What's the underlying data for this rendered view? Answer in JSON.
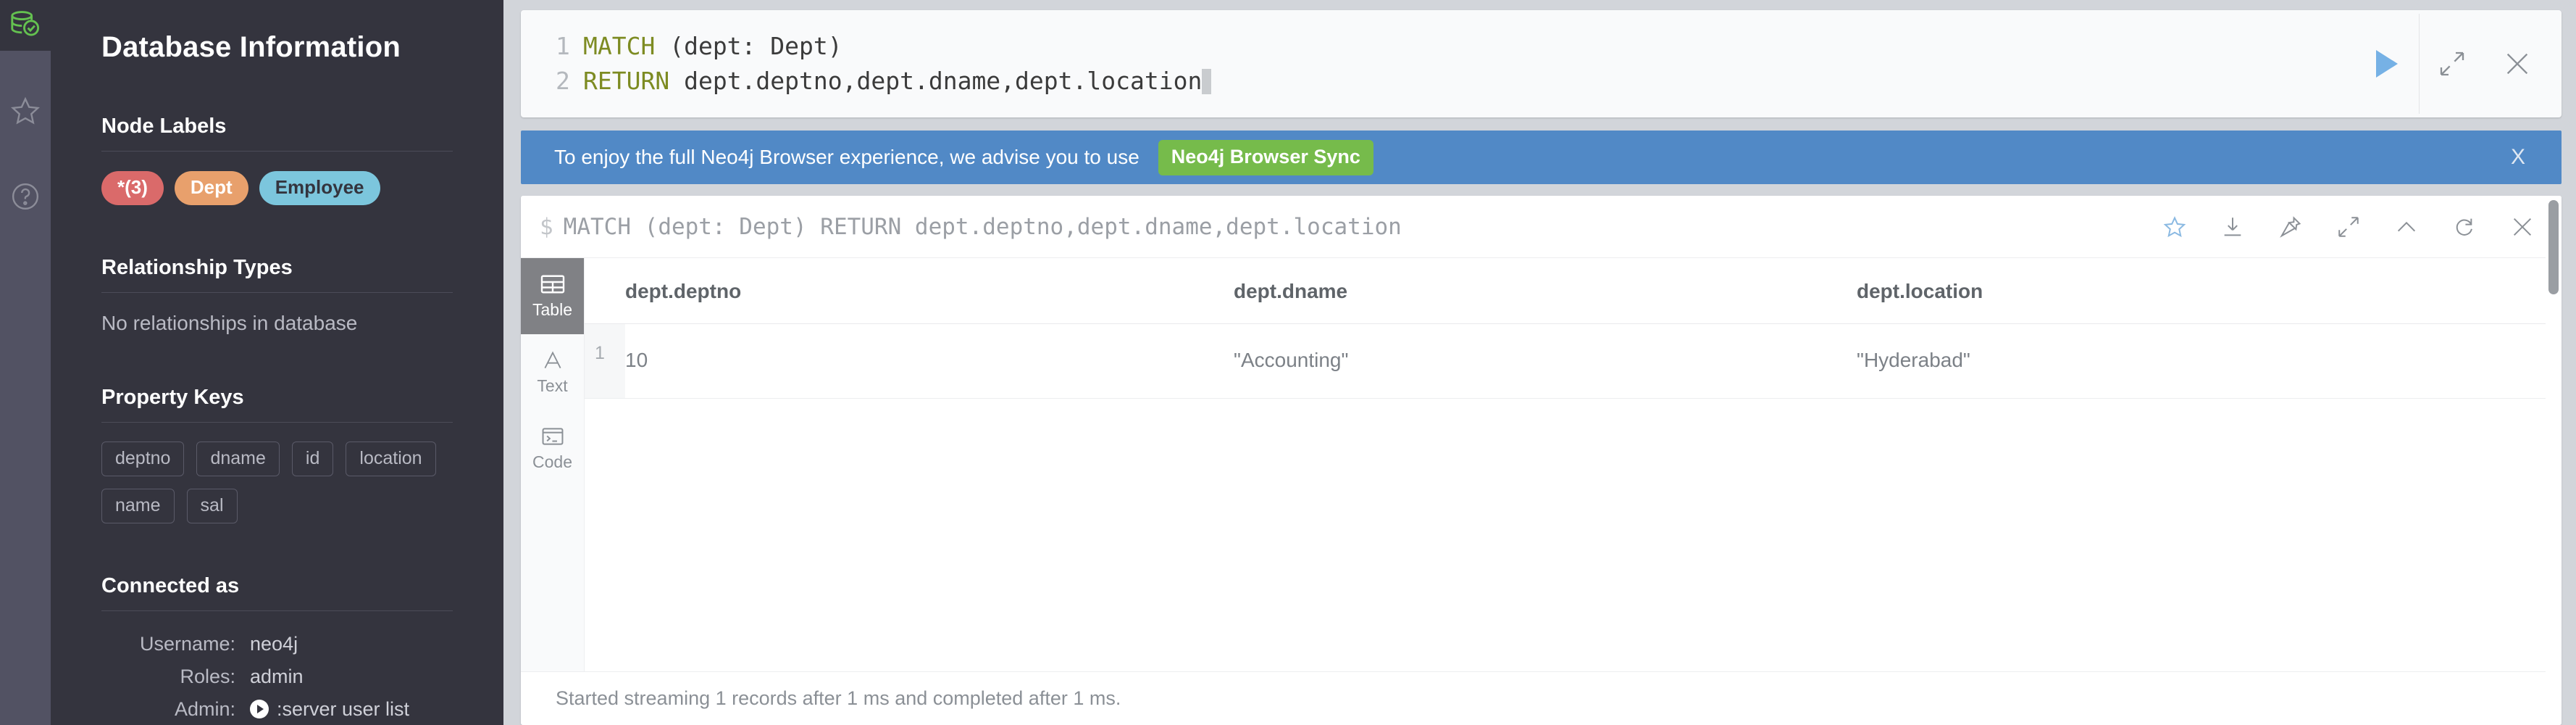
{
  "rail": {
    "items": [
      {
        "name": "database-icon",
        "label": "Database Information",
        "active": true
      },
      {
        "name": "favorites-star-icon",
        "label": "Favorites",
        "active": false
      },
      {
        "name": "help-circle-icon",
        "label": "Help and Learn",
        "active": false
      }
    ]
  },
  "sidebar": {
    "title": "Database Information",
    "node_labels": {
      "heading": "Node Labels",
      "chips": [
        {
          "label": "*(3)",
          "color": "#da6a6a",
          "text_color": "#ffffff"
        },
        {
          "label": "Dept",
          "color": "#e8a06c",
          "text_color": "#ffffff"
        },
        {
          "label": "Employee",
          "color": "#7cc6dd",
          "text_color": "#34343e"
        }
      ]
    },
    "relationship_types": {
      "heading": "Relationship Types",
      "empty_text": "No relationships in database"
    },
    "property_keys": {
      "heading": "Property Keys",
      "keys": [
        "deptno",
        "dname",
        "id",
        "location",
        "name",
        "sal"
      ]
    },
    "connected_as": {
      "heading": "Connected as",
      "rows": [
        {
          "label": "Username:",
          "value": "neo4j",
          "has_play": false
        },
        {
          "label": "Roles:",
          "value": "admin",
          "has_play": false
        },
        {
          "label": "Admin:",
          "value": ":server user list",
          "has_play": true
        }
      ]
    }
  },
  "editor": {
    "lines": [
      {
        "number": "1",
        "keyword": "MATCH",
        "rest": " (dept: Dept)"
      },
      {
        "number": "2",
        "keyword": "RETURN",
        "rest": " dept.deptno,dept.dname,dept.location"
      }
    ],
    "keyword_color": "#7d8b22",
    "buttons": [
      {
        "name": "run-query-button",
        "icon": "play-icon"
      },
      {
        "name": "fullscreen-editor-button",
        "icon": "expand-arrows-icon"
      },
      {
        "name": "close-editor-button",
        "icon": "close-icon"
      }
    ]
  },
  "banner": {
    "message": "To enjoy the full Neo4j Browser experience, we advise you to use",
    "cta_label": "Neo4j Browser Sync",
    "close_label": "X",
    "background": "#5189c6",
    "cta_background": "#76bb4b"
  },
  "frame": {
    "query": "MATCH (dept: Dept) RETURN dept.deptno,dept.dname,dept.location",
    "prompt": "$",
    "icons": [
      {
        "name": "favorite-star-icon",
        "title": "Save as favorite"
      },
      {
        "name": "download-icon",
        "title": "Export"
      },
      {
        "name": "pin-icon",
        "title": "Pin frame"
      },
      {
        "name": "fullscreen-icon",
        "title": "Fullscreen"
      },
      {
        "name": "collapse-chevron-icon",
        "title": "Collapse"
      },
      {
        "name": "rerun-icon",
        "title": "Rerun"
      },
      {
        "name": "close-frame-icon",
        "title": "Close"
      }
    ],
    "views": [
      {
        "name": "view-table",
        "label": "Table",
        "icon": "table-icon",
        "active": true
      },
      {
        "name": "view-text",
        "label": "Text",
        "icon": "text-a-icon",
        "active": false
      },
      {
        "name": "view-code",
        "label": "Code",
        "icon": "code-terminal-icon",
        "active": false
      }
    ],
    "table": {
      "columns": [
        "dept.deptno",
        "dept.dname",
        "dept.location"
      ],
      "rows": [
        {
          "index": "1",
          "cells": [
            "10",
            "\"Accounting\"",
            "\"Hyderabad\""
          ]
        }
      ]
    },
    "status": "Started streaming 1 records after 1 ms and completed after 1 ms."
  }
}
